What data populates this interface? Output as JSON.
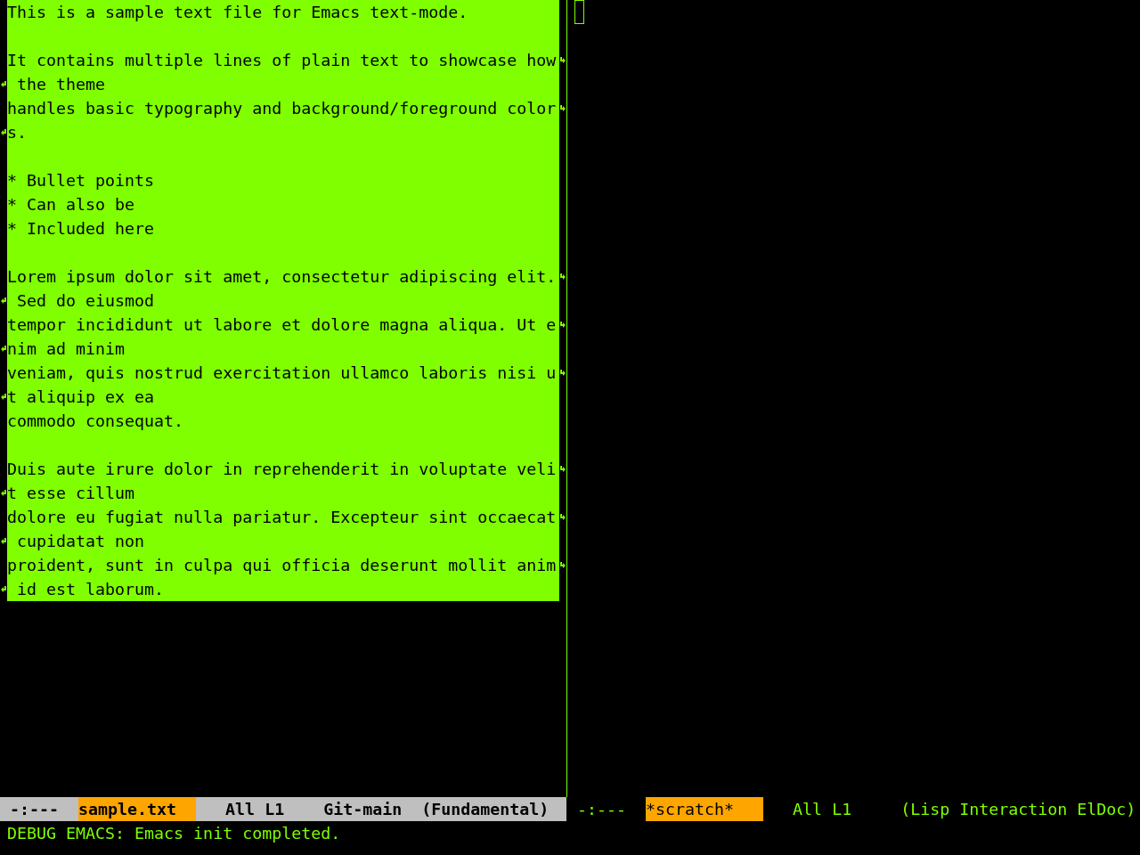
{
  "windows": [
    {
      "buffer": {
        "paragraphs": [
          {
            "rows": [
              {
                "text": "This is a sample text file for Emacs text-mode.",
                "wrapped": false
              }
            ]
          },
          {
            "rows": [
              {
                "text": "It contains multiple lines of plain text to showcase how",
                "wrapped": true
              },
              {
                "text": " the theme",
                "wrapped": false
              },
              {
                "text": "handles basic typography and background/foreground color",
                "wrapped": true
              },
              {
                "text": "s.",
                "wrapped": false
              }
            ]
          },
          {
            "rows": [
              {
                "text": "* Bullet points",
                "wrapped": false
              },
              {
                "text": "* Can also be",
                "wrapped": false
              },
              {
                "text": "* Included here",
                "wrapped": false
              }
            ]
          },
          {
            "rows": [
              {
                "text": "Lorem ipsum dolor sit amet, consectetur adipiscing elit.",
                "wrapped": true
              },
              {
                "text": " Sed do eiusmod",
                "wrapped": false
              },
              {
                "text": "tempor incididunt ut labore et dolore magna aliqua. Ut e",
                "wrapped": true
              },
              {
                "text": "nim ad minim",
                "wrapped": false
              },
              {
                "text": "veniam, quis nostrud exercitation ullamco laboris nisi u",
                "wrapped": true
              },
              {
                "text": "t aliquip ex ea",
                "wrapped": false
              },
              {
                "text": "commodo consequat.",
                "wrapped": false
              }
            ]
          },
          {
            "rows": [
              {
                "text": "Duis aute irure dolor in reprehenderit in voluptate veli",
                "wrapped": true
              },
              {
                "text": "t esse cillum",
                "wrapped": false
              },
              {
                "text": "dolore eu fugiat nulla pariatur. Excepteur sint occaecat",
                "wrapped": true
              },
              {
                "text": " cupidatat non",
                "wrapped": false
              },
              {
                "text": "proident, sunt in culpa qui officia deserunt mollit anim",
                "wrapped": true
              },
              {
                "text": " id est laborum.",
                "wrapped": false
              }
            ]
          }
        ]
      },
      "mode_line": {
        "active": true,
        "status": "-:---",
        "buffer_name": "sample.txt",
        "position": "All L1",
        "vc": "Git-main",
        "mode": "(Fundamental)"
      }
    },
    {
      "hollow_cursor": true,
      "mode_line": {
        "active": false,
        "status": "-:---",
        "buffer_name": "*scratch*",
        "position": "All L1",
        "mode": "(Lisp Interaction ElDoc)"
      }
    }
  ],
  "echo_area": "DEBUG EMACS: Emacs init completed."
}
